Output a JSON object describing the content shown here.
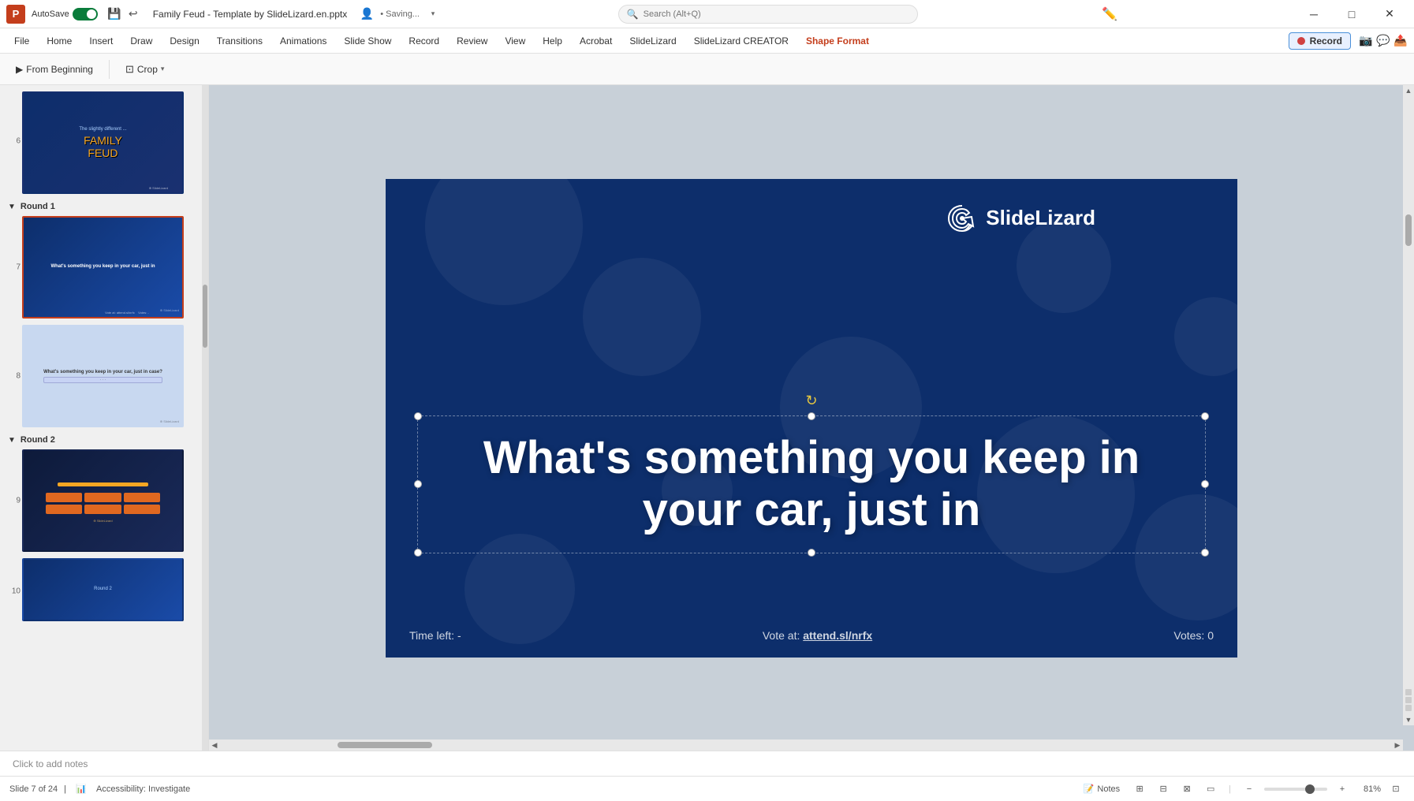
{
  "title_bar": {
    "app_name": "PowerPoint",
    "autosave_label": "AutoSave",
    "file_name": "Family Feud - Template by SlideLizard.en.pptx",
    "saving_status": "• Saving...",
    "search_placeholder": "Search (Alt+Q)",
    "minimize_label": "Minimize",
    "maximize_label": "Maximize",
    "close_label": "Close"
  },
  "menu_bar": {
    "items": [
      {
        "id": "file",
        "label": "File"
      },
      {
        "id": "home",
        "label": "Home"
      },
      {
        "id": "insert",
        "label": "Insert"
      },
      {
        "id": "draw",
        "label": "Draw"
      },
      {
        "id": "design",
        "label": "Design"
      },
      {
        "id": "transitions",
        "label": "Transitions"
      },
      {
        "id": "animations",
        "label": "Animations"
      },
      {
        "id": "slideshow",
        "label": "Slide Show"
      },
      {
        "id": "record",
        "label": "Record"
      },
      {
        "id": "review",
        "label": "Review"
      },
      {
        "id": "view",
        "label": "View"
      },
      {
        "id": "help",
        "label": "Help"
      },
      {
        "id": "acrobat",
        "label": "Acrobat"
      },
      {
        "id": "slidelizard",
        "label": "SlideLizard"
      },
      {
        "id": "slidelizard-creator",
        "label": "SlideLizard CREATOR"
      },
      {
        "id": "shape-format",
        "label": "Shape Format"
      }
    ],
    "record_button_label": "Record"
  },
  "toolbar": {
    "from_beginning_label": "From Beginning",
    "crop_label": "Crop",
    "dropdown_arrow": "▾"
  },
  "slide_panel": {
    "sections": [
      {
        "id": "round1",
        "label": "Round 1",
        "slides": [
          {
            "num": "7",
            "star": false,
            "active": true,
            "type": "question",
            "preview_text": "What's something you keep in your car, just in"
          },
          {
            "num": "8",
            "star": false,
            "active": false,
            "type": "answers",
            "preview_text": "What's something you keep in your car, just in case?"
          }
        ]
      },
      {
        "id": "round2",
        "label": "Round 2",
        "slides": [
          {
            "num": "9",
            "star": true,
            "active": false,
            "type": "scoreboard",
            "preview_text": ""
          },
          {
            "num": "10",
            "star": false,
            "active": false,
            "type": "round",
            "preview_text": ""
          }
        ]
      }
    ],
    "above_slides": [
      {
        "num": "6",
        "star": false,
        "active": false,
        "type": "family-feud",
        "preview_text": "The slightly different ... FAMILY FEUD"
      }
    ]
  },
  "canvas": {
    "slide_number": "Slide 7 of 24",
    "logo_text_light": "Slide",
    "logo_text_bold": "Lizard",
    "main_question": "What's something you keep in your car, just in",
    "footer": {
      "time_left_label": "Time left:",
      "time_left_value": "-",
      "vote_label": "Vote at:",
      "vote_url": "attend.sl/nrfx",
      "votes_label": "Votes:",
      "votes_value": "0"
    }
  },
  "status_bar": {
    "slide_info": "Slide 7 of 24",
    "accessibility_label": "Accessibility: Investigate",
    "notes_label": "Notes",
    "zoom_level": "81%",
    "click_to_add_notes": "Click to add notes"
  }
}
